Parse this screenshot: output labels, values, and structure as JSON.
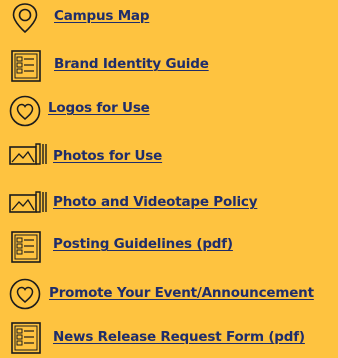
{
  "links": [
    {
      "label": "Campus Map",
      "icon": "map-pin-icon"
    },
    {
      "label": "Brand Identity Guide",
      "icon": "document-checklist-icon"
    },
    {
      "label": "Logos for Use",
      "icon": "heart-circle-icon"
    },
    {
      "label": "Photos for Use",
      "icon": "photo-stack-icon"
    },
    {
      "label": "Photo and Videotape Policy",
      "icon": "photo-stack-icon"
    },
    {
      "label": "Posting Guidelines (pdf)",
      "icon": "document-checklist-icon"
    },
    {
      "label": "Promote Your Event/Announcement",
      "icon": "heart-circle-icon"
    },
    {
      "label": "News Release Request Form (pdf)",
      "icon": "document-checklist-icon"
    }
  ]
}
